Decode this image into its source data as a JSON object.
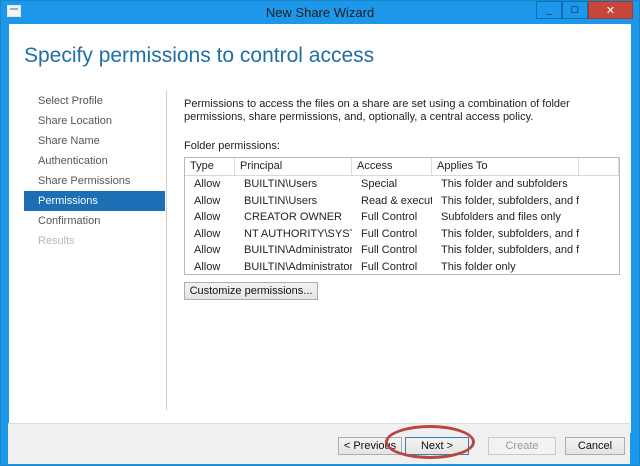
{
  "window": {
    "title": "New Share Wizard",
    "controls": {
      "minimize": "_",
      "maximize": "□",
      "close": "✕"
    }
  },
  "header": {
    "title": "Specify permissions to control access"
  },
  "nav": {
    "items": [
      {
        "label": "Select Profile",
        "state": "normal"
      },
      {
        "label": "Share Location",
        "state": "normal"
      },
      {
        "label": "Share Name",
        "state": "normal"
      },
      {
        "label": "Authentication",
        "state": "normal"
      },
      {
        "label": "Share Permissions",
        "state": "normal"
      },
      {
        "label": "Permissions",
        "state": "active"
      },
      {
        "label": "Confirmation",
        "state": "normal"
      },
      {
        "label": "Results",
        "state": "disabled"
      }
    ]
  },
  "main": {
    "description": "Permissions to access the files on a share are set using a combination of folder permissions, share permissions, and, optionally, a central access policy.",
    "folder_permissions_label": "Folder permissions:",
    "table": {
      "columns": [
        "Type",
        "Principal",
        "Access",
        "Applies To"
      ],
      "rows": [
        [
          "Allow",
          "BUILTIN\\Users",
          "Special",
          "This folder and subfolders"
        ],
        [
          "Allow",
          "BUILTIN\\Users",
          "Read & execute",
          "This folder, subfolders, and files"
        ],
        [
          "Allow",
          "CREATOR OWNER",
          "Full Control",
          "Subfolders and files only"
        ],
        [
          "Allow",
          "NT AUTHORITY\\SYSTEM",
          "Full Control",
          "This folder, subfolders, and files"
        ],
        [
          "Allow",
          "BUILTIN\\Administrators",
          "Full Control",
          "This folder, subfolders, and files"
        ],
        [
          "Allow",
          "BUILTIN\\Administrators",
          "Full Control",
          "This folder only"
        ]
      ]
    },
    "customize_label": "Customize permissions..."
  },
  "footer": {
    "previous_label": "< Previous",
    "next_label": "Next >",
    "create_label": "Create",
    "cancel_label": "Cancel"
  },
  "colors": {
    "titlebar": "#1c97ea",
    "accent": "#1c6fb5",
    "header_text": "#1e6ea7",
    "annotation": "#b8473f",
    "close_button": "#c7463c"
  }
}
